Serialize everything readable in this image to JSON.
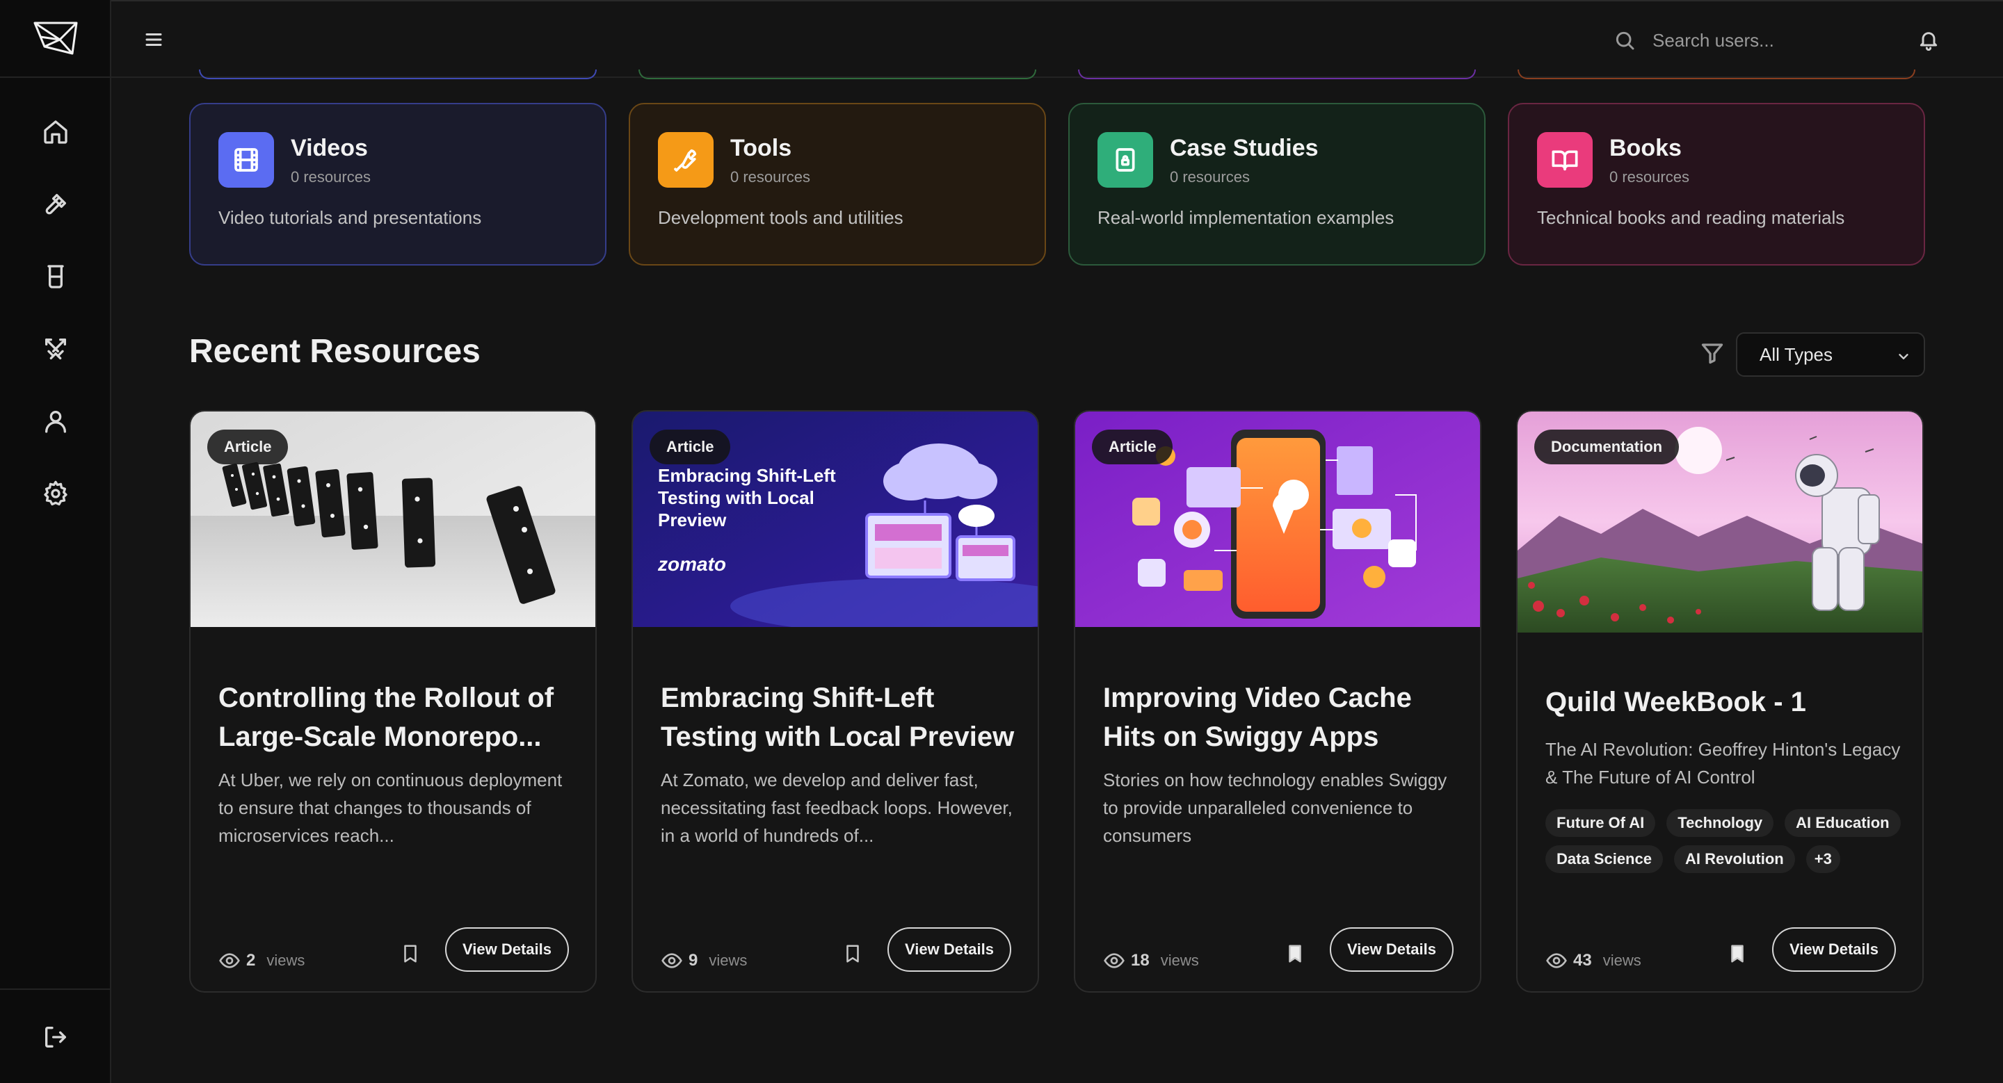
{
  "header": {
    "search_placeholder": "Search users..."
  },
  "sidebar": {
    "items": [
      {
        "name": "home-icon"
      },
      {
        "name": "hammer-icon"
      },
      {
        "name": "beaker-icon"
      },
      {
        "name": "swords-icon"
      },
      {
        "name": "user-icon"
      },
      {
        "name": "gear-icon"
      }
    ],
    "logout": "logout-icon"
  },
  "categories": [
    {
      "title": "Videos",
      "count": "0 resources",
      "description": "Video tutorials and presentations",
      "icon": "film-icon",
      "color": "#5b6cf2"
    },
    {
      "title": "Tools",
      "count": "0 resources",
      "description": "Development tools and utilities",
      "icon": "wrench-icon",
      "color": "#f59a17"
    },
    {
      "title": "Case Studies",
      "count": "0 resources",
      "description": "Real-world implementation examples",
      "icon": "clipboard-lock-icon",
      "color": "#2fae7a"
    },
    {
      "title": "Books",
      "count": "0 resources",
      "description": "Technical books and reading materials",
      "icon": "book-open-icon",
      "color": "#ea3b7c"
    }
  ],
  "recent": {
    "title": "Recent Resources",
    "filter_value": "All Types"
  },
  "resources": [
    {
      "type": "Article",
      "title": "Controlling the Rollout of Large-Scale Monorepo...",
      "description": "At Uber, we rely on continuous deployment to ensure that changes to thousands of microservices reach...",
      "views": "2",
      "views_label": "views",
      "action": "View Details",
      "bookmarked": false
    },
    {
      "type": "Article",
      "thumb_title": "Embracing Shift-Left Testing with Local Preview",
      "thumb_brand": "zomato",
      "title": "Embracing Shift-Left Testing with Local Preview",
      "description": "At Zomato, we develop and deliver fast, necessitating fast feedback loops. However, in a world of hundreds of...",
      "views": "9",
      "views_label": "views",
      "action": "View Details",
      "bookmarked": false
    },
    {
      "type": "Article",
      "title": "Improving Video Cache Hits on Swiggy Apps",
      "description": "Stories on how technology enables Swiggy to provide unparalleled convenience to consumers",
      "views": "18",
      "views_label": "views",
      "action": "View Details",
      "bookmarked": true
    },
    {
      "type": "Documentation",
      "title": "Quild WeekBook - 1",
      "description": "The AI Revolution: Geoffrey Hinton's Legacy & The Future of AI Control",
      "tags": [
        "Future Of AI",
        "Technology",
        "AI Education",
        "Data Science",
        "AI Revolution",
        "+3"
      ],
      "views": "43",
      "views_label": "views",
      "action": "View Details",
      "bookmarked": true
    }
  ]
}
